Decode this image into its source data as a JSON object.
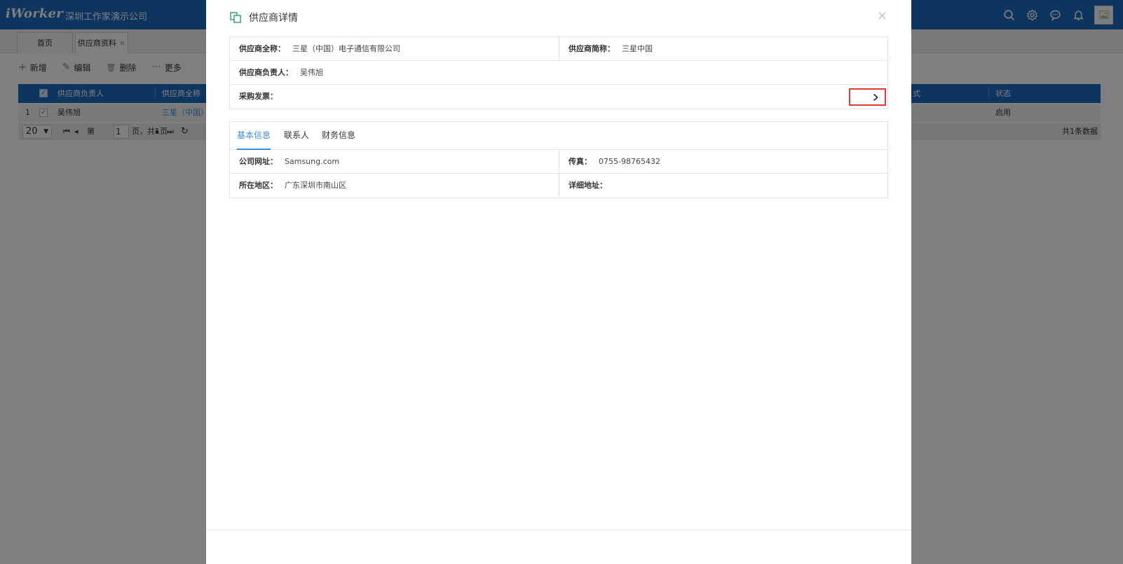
{
  "app": {
    "logo": "iWorker",
    "company": "深圳工作家演示公司",
    "icons": [
      "search-icon",
      "settings-icon",
      "chat-icon",
      "bell-icon",
      "avatar"
    ]
  },
  "page_tabs": [
    {
      "label": "首页"
    },
    {
      "label": "供应商资料",
      "close": "×"
    }
  ],
  "toolbar": {
    "add": {
      "icon": "+",
      "label": "新增"
    },
    "edit": {
      "icon": "✎",
      "label": "编辑"
    },
    "delete": {
      "icon": "🗑",
      "label": "删除"
    },
    "more": {
      "icon": "···",
      "label": "更多"
    }
  },
  "grid": {
    "columns": [
      "供应商负责人",
      "供应商全称",
      "式",
      "状态"
    ],
    "row": {
      "index": "1",
      "owner": "吴伟旭",
      "name": "三星（中国）",
      "status": "启用"
    },
    "pager": {
      "page_size": "20",
      "page_prefix": "第",
      "page": "1",
      "page_suffix": "页，共1页",
      "total": "共1条数据"
    }
  },
  "modal": {
    "title": "供应商详情",
    "close": "×",
    "summary": {
      "full_name_label": "供应商全称：",
      "full_name": "三星（中国）电子通信有限公司",
      "short_name_label": "供应商简称：",
      "short_name": "三星中国",
      "owner_label": "供应商负责人：",
      "owner": "吴伟旭",
      "invoice_label": "采购发票："
    },
    "tabs": [
      {
        "label": "基本信息",
        "active": true
      },
      {
        "label": "联系人",
        "active": false
      },
      {
        "label": "财务信息",
        "active": false
      }
    ],
    "basic": {
      "website_label": "公司网址：",
      "website": "Samsung.com",
      "fax_label": "传真：",
      "fax": "0755-98765432",
      "region_label": "所在地区：",
      "region": "广东深圳市南山区",
      "address_label": "详细地址：",
      "address": ""
    }
  },
  "colors": {
    "primary": "#1b6bc1",
    "tab_active": "#3a8ee6",
    "highlight": "#e53935",
    "icon_green": "#2eaa6d"
  }
}
